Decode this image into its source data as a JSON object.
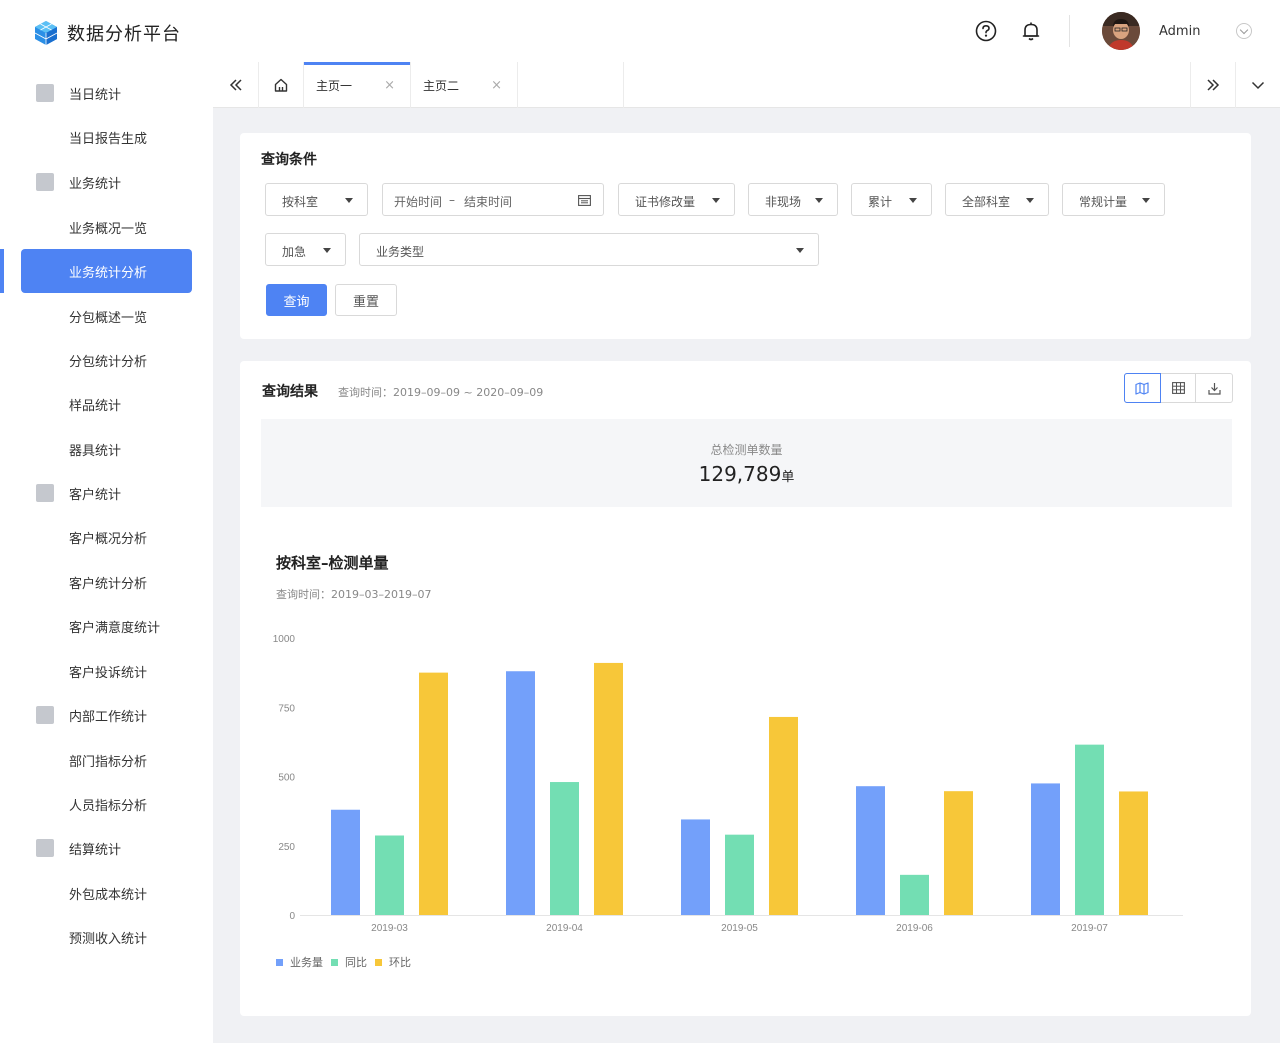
{
  "app": {
    "title": "数据分析平台"
  },
  "header": {
    "user_name": "Admin",
    "help_icon": "question-circle-icon",
    "bell_icon": "bell-icon"
  },
  "sidebar": {
    "items": [
      {
        "label": "当日统计",
        "level": 1,
        "icon": "check-square-icon"
      },
      {
        "label": "当日报告生成",
        "level": 2
      },
      {
        "label": "业务统计",
        "level": 1,
        "icon": "bar-chart-icon"
      },
      {
        "label": "业务概况一览",
        "level": 2
      },
      {
        "label": "业务统计分析",
        "level": 2,
        "active": true
      },
      {
        "label": "分包概述一览",
        "level": 2
      },
      {
        "label": "分包统计分析",
        "level": 2
      },
      {
        "label": "样品统计",
        "level": 2
      },
      {
        "label": "器具统计",
        "level": 2
      },
      {
        "label": "客户统计",
        "level": 1,
        "icon": "user-card-icon"
      },
      {
        "label": "客户概况分析",
        "level": 2
      },
      {
        "label": "客户统计分析",
        "level": 2
      },
      {
        "label": "客户满意度统计",
        "level": 2
      },
      {
        "label": "客户投诉统计",
        "level": 2
      },
      {
        "label": "内部工作统计",
        "level": 1,
        "icon": "line-chart-icon"
      },
      {
        "label": "部门指标分析",
        "level": 2
      },
      {
        "label": "人员指标分析",
        "level": 2
      },
      {
        "label": "结算统计",
        "level": 1,
        "icon": "yen-calendar-icon"
      },
      {
        "label": "外包成本统计",
        "level": 2
      },
      {
        "label": "预测收入统计",
        "level": 2
      }
    ]
  },
  "tabs": {
    "items": [
      {
        "label": "主页一",
        "active": true
      },
      {
        "label": "主页二",
        "active": false
      }
    ],
    "close_symbol": "×"
  },
  "query": {
    "title": "查询条件",
    "filters_row1": [
      "按科室",
      "证书修改量",
      "非现场",
      "累计",
      "全部科室",
      "常规计量"
    ],
    "date_start": "开始时间",
    "date_sep": "–",
    "date_end": "结束时间",
    "filter_urgent": "加急",
    "filter_business_type": "业务类型",
    "search_label": "查询",
    "reset_label": "重置"
  },
  "results": {
    "title": "查询结果",
    "query_time": "查询时间：2019–09–09 ~ 2020–09–09",
    "total_label": "总检测单数量",
    "total_value": "129,789",
    "total_unit": "单",
    "view_icons": [
      "map-icon",
      "table-icon",
      "download-icon"
    ]
  },
  "chart": {
    "title": "按科室–检测单量",
    "subtitle": "查询时间：2019–03–2019–07"
  },
  "chart_data": {
    "type": "bar",
    "title": "按科室–检测单量",
    "categories": [
      "2019-03",
      "2019-04",
      "2019-05",
      "2019-06",
      "2019-07"
    ],
    "series": [
      {
        "name": "业务量",
        "color": "#73a0fa",
        "values": [
          380,
          880,
          345,
          465,
          475
        ]
      },
      {
        "name": "同比",
        "color": "#73deb3",
        "values": [
          287,
          480,
          290,
          145,
          615
        ]
      },
      {
        "name": "环比",
        "color": "#f7c739",
        "values": [
          875,
          910,
          715,
          447,
          446
        ]
      }
    ],
    "yticks": [
      0,
      250,
      500,
      750,
      1000
    ],
    "ylim": [
      0,
      1000
    ],
    "legend": "bottom-left",
    "grid": false
  }
}
